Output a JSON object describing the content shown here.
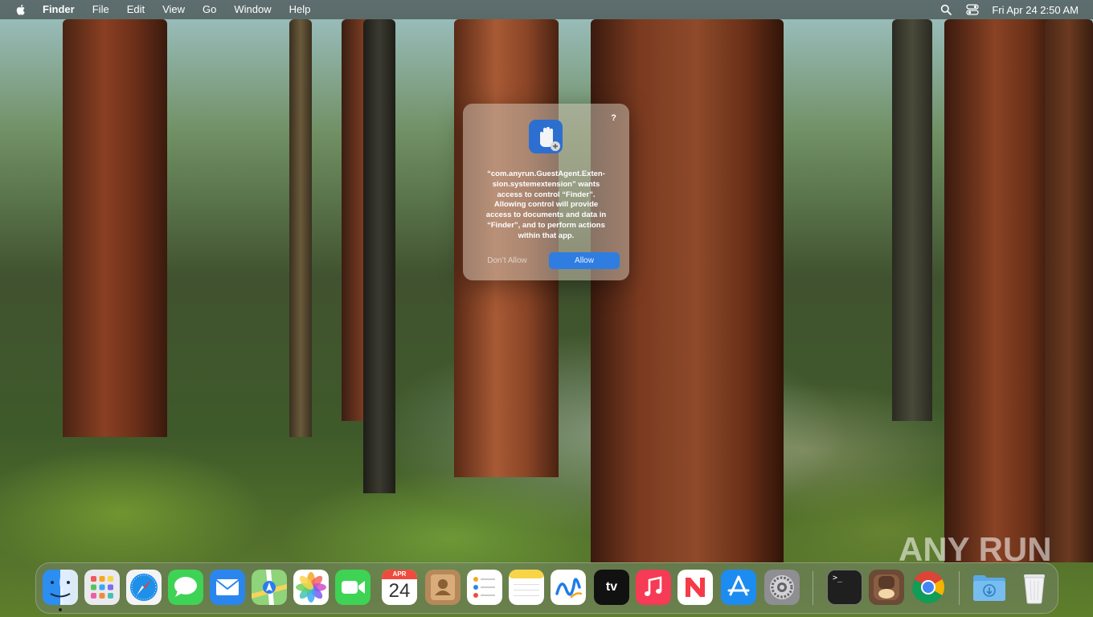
{
  "menubar": {
    "app_name": "Finder",
    "menus": [
      "File",
      "Edit",
      "View",
      "Go",
      "Window",
      "Help"
    ],
    "clock": "Fri Apr 24  2:50 AM"
  },
  "dialog": {
    "help_label": "?",
    "message": "“com.anyrun.GuestAgent.Extension.systemextension” wants access to control “Finder”. Allowing control will provide access to documents and data in “Finder”, and to perform actions within that app.",
    "message_lines": [
      "“com.anyrun.GuestAgent.Exten-",
      "sion.systemextension” wants",
      "access to control “Finder”.",
      "Allowing control will provide",
      "access to documents and data in",
      "“Finder”, and to perform actions",
      "within that app."
    ],
    "deny_label": "Don’t Allow",
    "allow_label": "Allow"
  },
  "dock": {
    "items": [
      {
        "name": "Finder",
        "icon": "finder-icon"
      },
      {
        "name": "Launchpad",
        "icon": "launchpad-icon"
      },
      {
        "name": "Safari",
        "icon": "safari-icon"
      },
      {
        "name": "Messages",
        "icon": "messages-icon"
      },
      {
        "name": "Mail",
        "icon": "mail-icon"
      },
      {
        "name": "Maps",
        "icon": "maps-icon"
      },
      {
        "name": "Photos",
        "icon": "photos-icon"
      },
      {
        "name": "FaceTime",
        "icon": "facetime-icon"
      },
      {
        "name": "Calendar",
        "icon": "calendar-icon",
        "month": "APR",
        "day": "24"
      },
      {
        "name": "Contacts",
        "icon": "contacts-icon"
      },
      {
        "name": "Reminders",
        "icon": "reminders-icon"
      },
      {
        "name": "Notes",
        "icon": "notes-icon"
      },
      {
        "name": "Freeform",
        "icon": "freeform-icon"
      },
      {
        "name": "TV",
        "icon": "tv-icon",
        "label": "tv"
      },
      {
        "name": "Music",
        "icon": "music-icon"
      },
      {
        "name": "News",
        "icon": "news-icon"
      },
      {
        "name": "App Store",
        "icon": "app-store-icon"
      },
      {
        "name": "System Settings",
        "icon": "settings-icon"
      },
      {
        "name": "Terminal",
        "icon": "terminal-icon",
        "label": ">_"
      },
      {
        "name": "Unknown App",
        "icon": "app-icon"
      },
      {
        "name": "Chrome",
        "icon": "chrome-icon"
      },
      {
        "name": "Downloads",
        "icon": "downloads-folder-icon"
      },
      {
        "name": "Trash",
        "icon": "trash-icon"
      }
    ]
  },
  "watermark": "ANY RUN",
  "colors": {
    "allow_button": "#2f7de1",
    "menubar_bg": "#282828"
  }
}
